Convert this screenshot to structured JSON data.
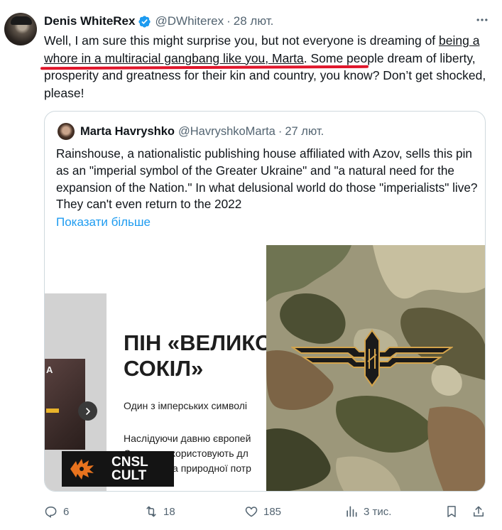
{
  "tweet": {
    "display_name": "Denis WhiteRex",
    "handle": "@DWhiterex",
    "separator": "·",
    "date": "28 лют.",
    "more_icon": "more-horizontal-icon",
    "text_pre": "Well, I am sure this might surprise you, but not everyone is dreaming of ",
    "text_highlight": "being a whore in a multiracial gangbang like you, Marta",
    "text_post": ". Some people dream of liberty, prosperity and greatness for their kin and country, you know? Don’t get shocked, please!",
    "annotation_color": "#e0162b"
  },
  "quote": {
    "display_name": "Marta Havryshko",
    "handle": "@HavryshkoMarta",
    "separator": "·",
    "date": "27 лют.",
    "text": "Rainshouse, a nationalistic publishing house affiliated with Azov, sells this pin as an \"imperial symbol of the Greater Ukraine\" and \"a natural need for the expansion of the Nation.\" In what delusional world do those \"imperialists\" live? They can't even return to the 2022",
    "show_more": "Показати більше",
    "media": {
      "book_letter": "A",
      "pin_title_line1": "ПІН «ВЕЛИКО",
      "pin_title_line2": "СОКІЛ»",
      "pin_subtitle": "Один з імперських символі",
      "pin_desc_line1": "Наслідуючи давню європей",
      "pin_desc_line2": "Сокола використовують дл",
      "pin_desc_line3": "українців та природної потр",
      "logo_line1": "CNSL",
      "logo_line2": "CULT",
      "logo_color": "#e8731e"
    }
  },
  "actions": {
    "reply_count": "6",
    "retweet_count": "18",
    "like_count": "185",
    "views_count": "3 тис.",
    "accent_color": "#1d9bf0",
    "text_color": "#536471"
  }
}
